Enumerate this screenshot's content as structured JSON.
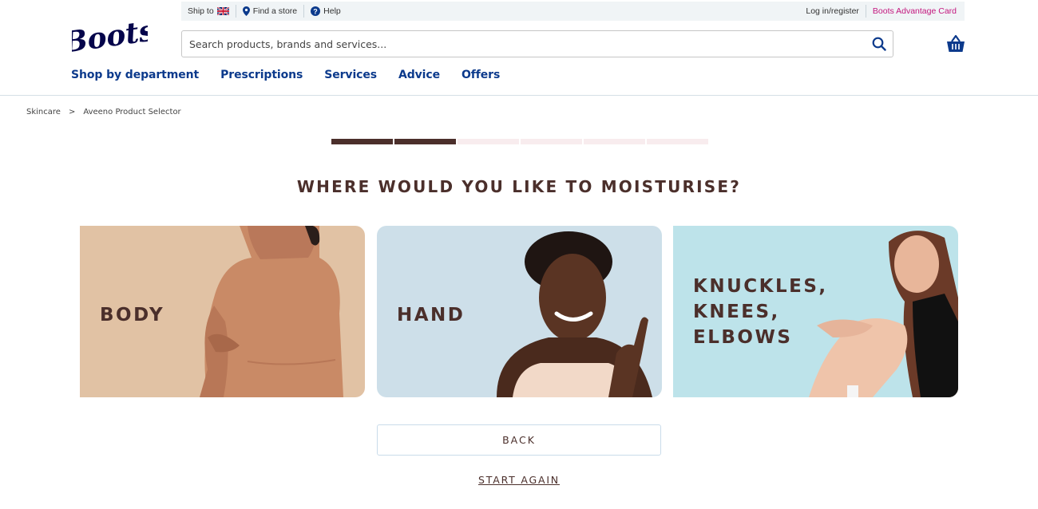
{
  "header": {
    "logo_text": "Boots",
    "utility": {
      "ship_to": "Ship to",
      "find_store": "Find a store",
      "help": "Help",
      "login": "Log in/register",
      "advantage_card": "Boots Advantage Card"
    },
    "search": {
      "placeholder": "Search products, brands and services..."
    },
    "nav": [
      "Shop by department",
      "Prescriptions",
      "Services",
      "Advice",
      "Offers"
    ]
  },
  "breadcrumb": {
    "items": [
      "Skincare",
      "Aveeno Product Selector"
    ],
    "separator": ">"
  },
  "progress": {
    "total_steps": 6,
    "completed_steps": 2
  },
  "question": "WHERE WOULD YOU LIKE TO MOISTURISE?",
  "options": [
    {
      "label": "BODY"
    },
    {
      "label": "HAND"
    },
    {
      "label": "KNUCKLES,\nKNEES,\nELBOWS"
    }
  ],
  "actions": {
    "back": "BACK",
    "start_again": "START AGAIN"
  },
  "colors": {
    "brand_blue": "#05054b",
    "nav_blue": "#0c3a8c",
    "accent_pink": "#c3177e",
    "text_brown": "#4b2f2b"
  }
}
